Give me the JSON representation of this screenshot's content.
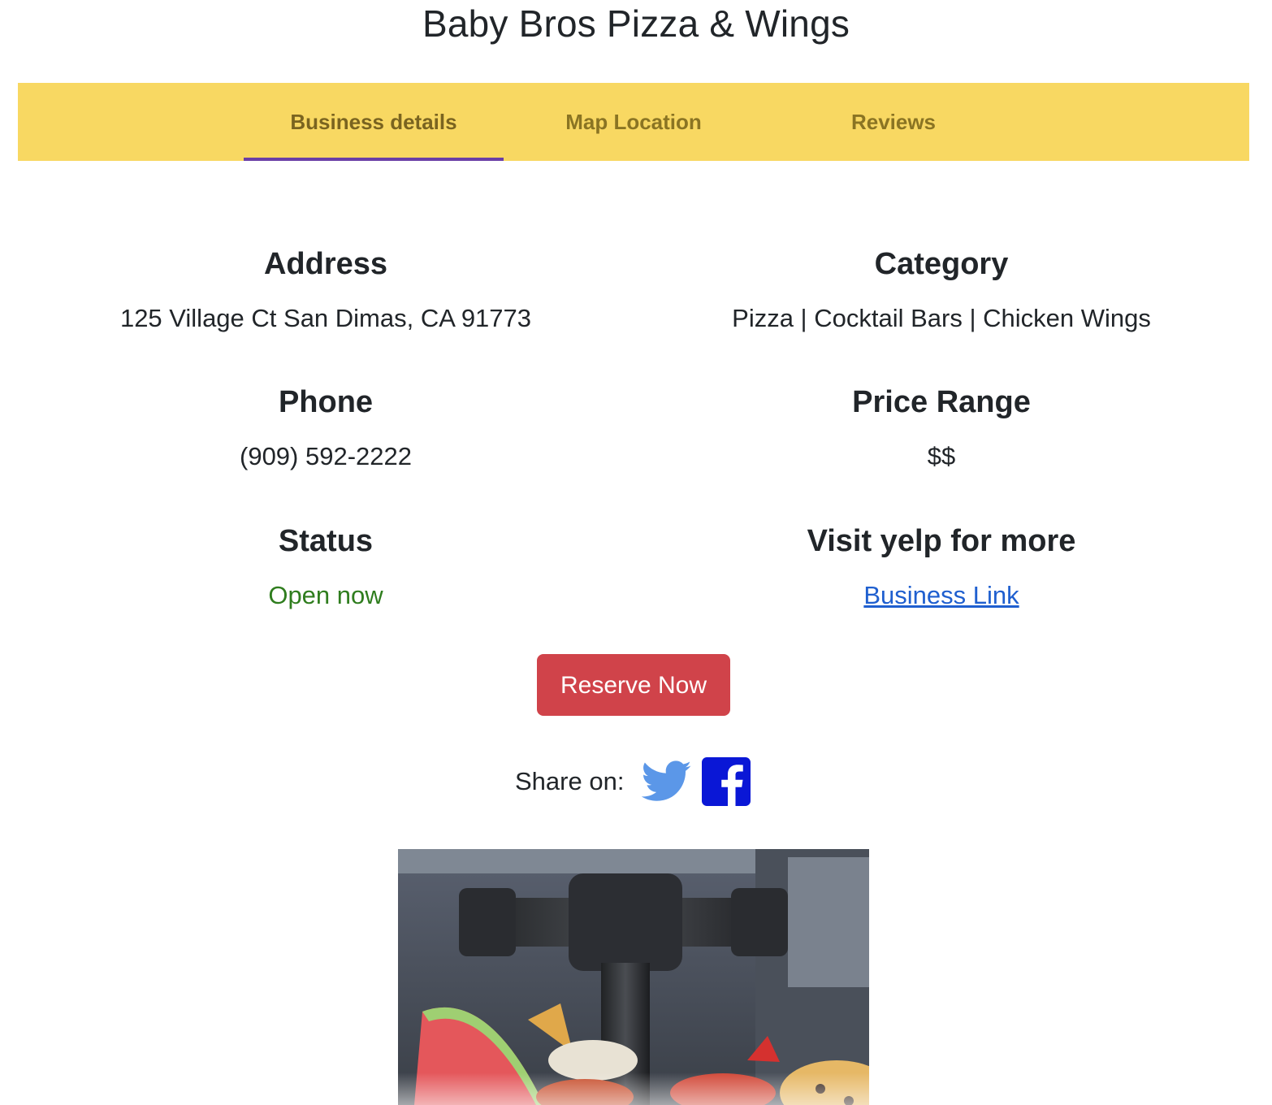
{
  "page": {
    "title": "Baby Bros Pizza & Wings"
  },
  "tabs": [
    {
      "label": "Business details",
      "active": true
    },
    {
      "label": "Map Location",
      "active": false
    },
    {
      "label": "Reviews",
      "active": false
    }
  ],
  "details": {
    "address": {
      "heading": "Address",
      "value": "125 Village Ct San Dimas, CA 91773"
    },
    "category": {
      "heading": "Category",
      "value": "Pizza | Cocktail Bars | Chicken Wings"
    },
    "phone": {
      "heading": "Phone",
      "value": "(909) 592-2222"
    },
    "price_range": {
      "heading": "Price Range",
      "value": "$$"
    },
    "status": {
      "heading": "Status",
      "value": "Open now"
    },
    "yelp": {
      "heading": "Visit yelp for more",
      "link_label": "Business Link"
    }
  },
  "actions": {
    "reserve_label": "Reserve Now"
  },
  "share": {
    "label": "Share on:",
    "icons": [
      "twitter-icon",
      "facebook-icon"
    ]
  },
  "colors": {
    "tab_bar": "#f8d862",
    "tab_underline": "#6a3fa6",
    "status_open": "#2f7d1e",
    "link": "#1f5fcf",
    "reserve_button": "#d0434a",
    "twitter": "#5b97e8",
    "facebook": "#0a17d6"
  }
}
